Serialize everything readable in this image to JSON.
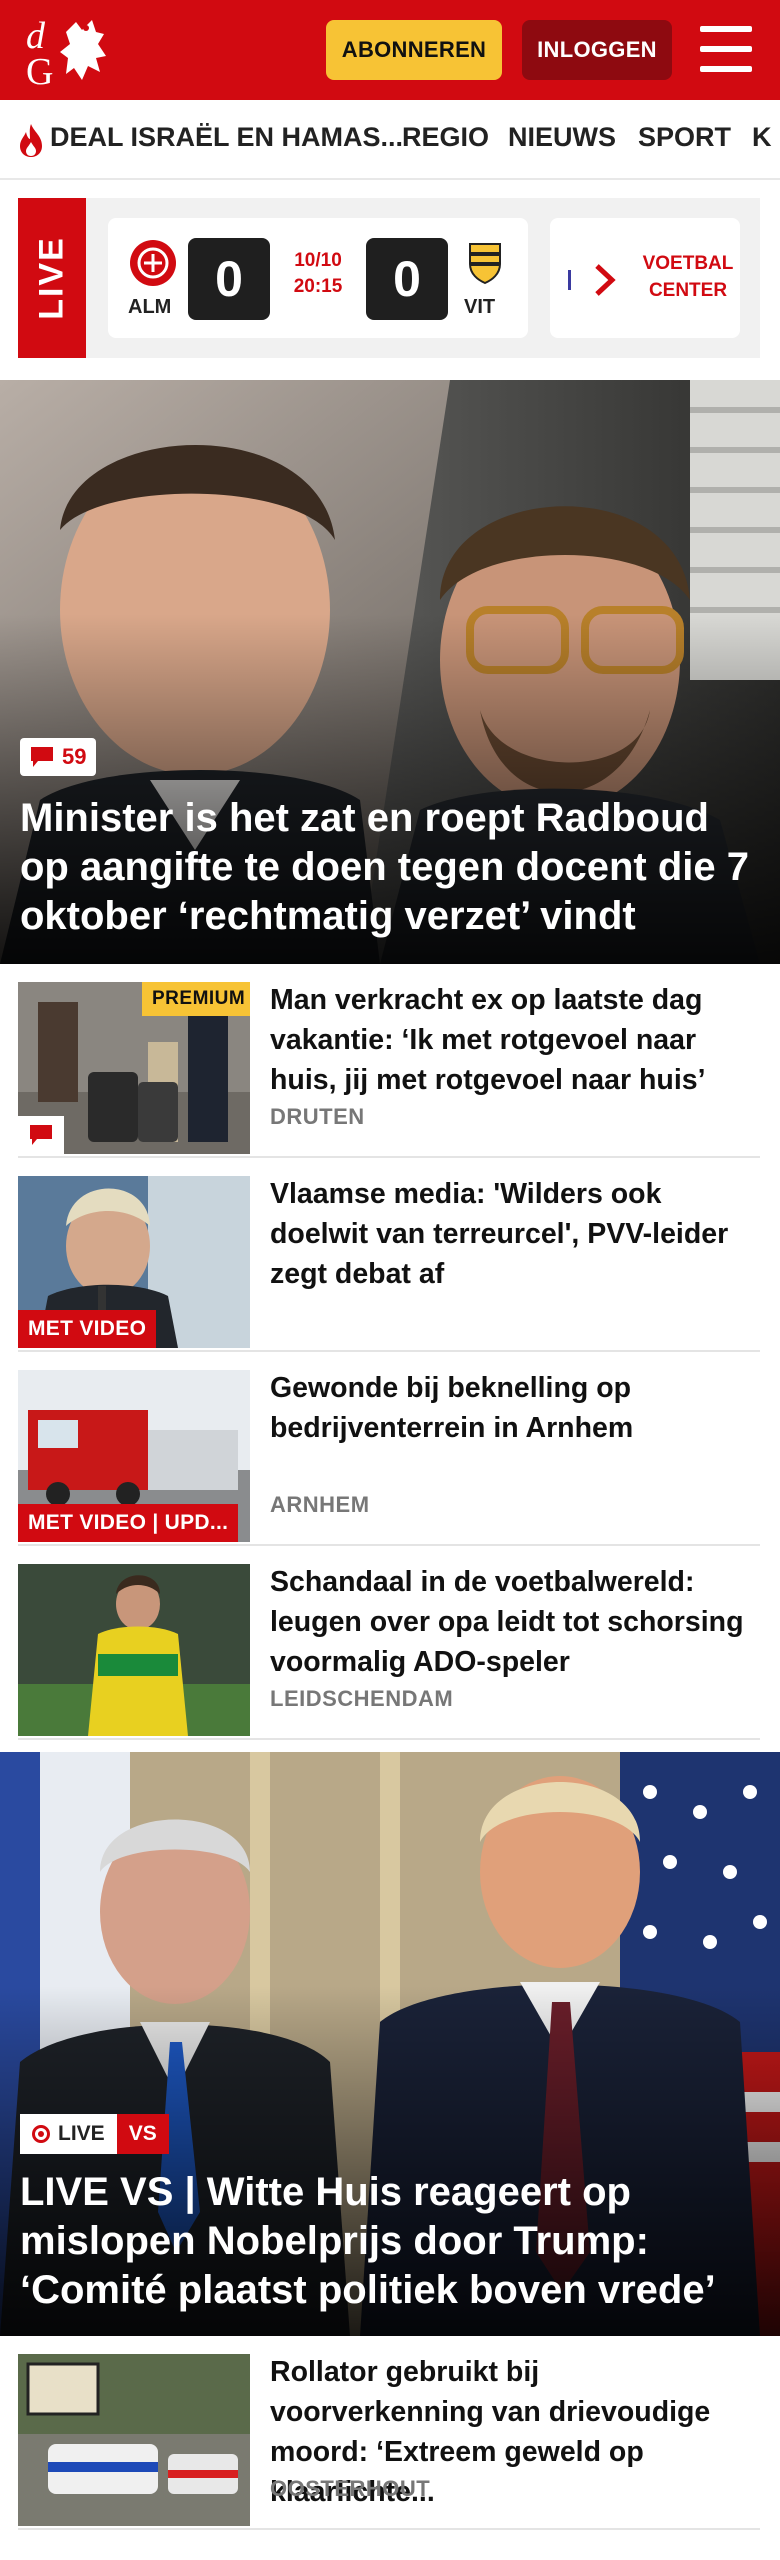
{
  "header": {
    "logo_text": "dG",
    "subscribe_label": "ABONNEREN",
    "login_label": "INLOGGEN",
    "brand_color": "#d10a11",
    "accent_color": "#f7c335"
  },
  "nav": {
    "items": [
      {
        "label": "DEAL ISRAËL EN HAMAS...",
        "icon": "fire-icon"
      },
      {
        "label": "REGIO"
      },
      {
        "label": "NIEUWS"
      },
      {
        "label": "SPORT"
      },
      {
        "label": "K"
      }
    ]
  },
  "live": {
    "label": "LIVE",
    "match": {
      "home": "ALM",
      "away": "VIT",
      "home_score": "0",
      "away_score": "0",
      "date": "10/10",
      "time": "20:15"
    },
    "football_center": "VOETBAL CENTER"
  },
  "hero1": {
    "comments": "59",
    "title": "Minister is het zat en roept Radboud op aangifte te doen tegen docent die 7 oktober ‘rechtmatig verzet’ vindt"
  },
  "articles": [
    {
      "title": "Man verkracht ex op laatste dag vakantie: ‘Ik met rotgevoel naar huis, jij met rotgevoel naar huis’",
      "meta": "DRUTEN",
      "badge": "PREMIUM"
    },
    {
      "title": "Vlaamse media: 'Wilders ook doelwit van terreurcel', PVV-leider zegt debat af",
      "meta": "",
      "badge": "MET VIDEO"
    },
    {
      "title": "Gewonde bij beknelling op bedrijventerrein in Arnhem",
      "meta": "ARNHEM",
      "badge": "MET VIDEO | UPD..."
    },
    {
      "title": "Schandaal in de voetbalwereld: leugen over opa leidt tot schorsing voormalig ADO-speler",
      "meta": "LEIDSCHENDAM",
      "badge": ""
    }
  ],
  "hero2": {
    "live_label": "LIVE",
    "tag": "VS",
    "title": "LIVE VS | Witte Huis reageert op mislopen Nobelprijs door Trump: ‘Comité plaatst politiek boven vrede’"
  },
  "article5": {
    "title": "Rollator gebruikt bij voorverkenning van drievoudige moord: ‘Extreem geweld op klaarlichte...",
    "meta": "OOSTERHOUT"
  }
}
